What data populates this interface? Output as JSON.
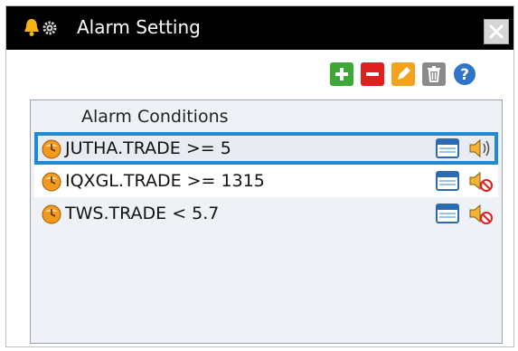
{
  "window": {
    "title": "Alarm Setting"
  },
  "titlebar_icons": [
    "bell-icon",
    "gear-icon"
  ],
  "toolbar": {
    "buttons": [
      {
        "name": "add",
        "icon": "plus-icon",
        "color": "#3aa935"
      },
      {
        "name": "remove",
        "icon": "minus-icon",
        "color": "#e02020"
      },
      {
        "name": "edit",
        "icon": "pencil-icon",
        "color": "#f4a11d"
      },
      {
        "name": "delete",
        "icon": "trash-icon",
        "color": "#8a8a8a"
      },
      {
        "name": "help",
        "icon": "help-icon",
        "color": "#2f74c8"
      }
    ]
  },
  "alarms": {
    "header": "Alarm Conditions",
    "rows": [
      {
        "condition": "JUTHA.TRADE >= 5",
        "selected": true,
        "sound": "on"
      },
      {
        "condition": "IQXGL.TRADE >= 1315",
        "selected": false,
        "sound": "off"
      },
      {
        "condition": "TWS.TRADE < 5.7",
        "selected": false,
        "sound": "off"
      }
    ]
  },
  "colors": {
    "titlebar": "#000000",
    "selection_border": "#1f8ad0",
    "panel_bg": "#eef1f5"
  }
}
